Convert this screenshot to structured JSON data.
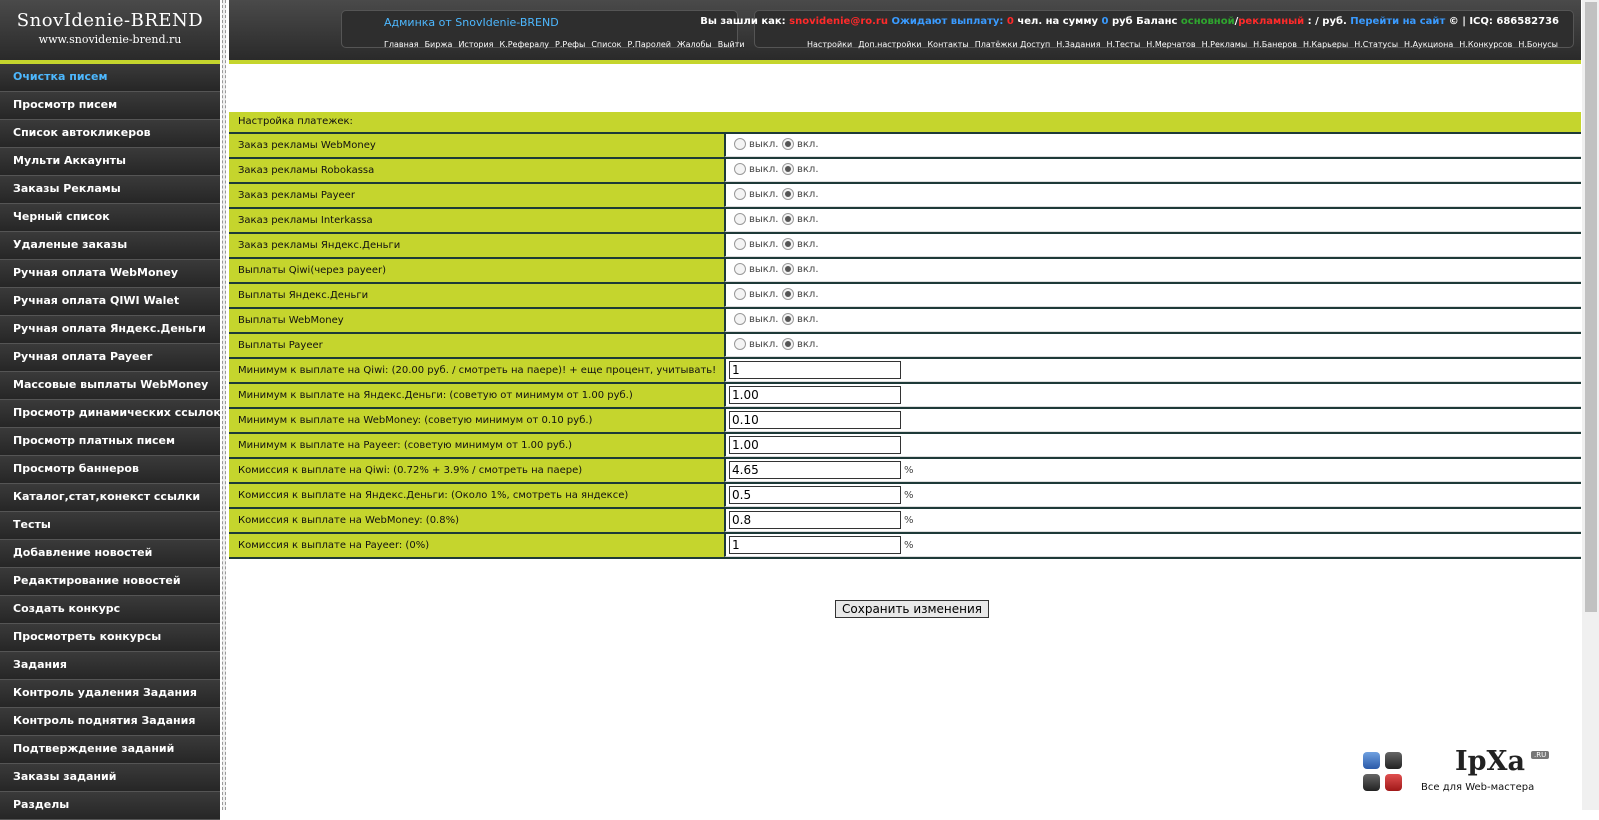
{
  "logo": {
    "title": "SnovIdenie-BREND",
    "url": "www.snovidenie-brend.ru"
  },
  "sidebar": {
    "items": [
      {
        "label": "Очистка писем",
        "active": true
      },
      {
        "label": "Просмотр писем"
      },
      {
        "label": "Список автокликеров"
      },
      {
        "label": "Мульти Аккаунты"
      },
      {
        "label": "Заказы Рекламы"
      },
      {
        "label": "Черный список"
      },
      {
        "label": "Удаленые заказы"
      },
      {
        "label": "Ручная оплата WebMoney"
      },
      {
        "label": "Ручная оплата QIWI Walet"
      },
      {
        "label": "Ручная оплата Яндекс.Деньги"
      },
      {
        "label": "Ручная оплата Payeer"
      },
      {
        "label": "Массовые выплаты WebMoney"
      },
      {
        "label": "Просмотр динамических ссылок"
      },
      {
        "label": "Просмотр платных писем"
      },
      {
        "label": "Просмотр баннеров"
      },
      {
        "label": "Каталог,стат,конекст ссылки"
      },
      {
        "label": "Тесты"
      },
      {
        "label": "Добавление новостей"
      },
      {
        "label": "Редактирование новостей"
      },
      {
        "label": "Создать конкурс"
      },
      {
        "label": "Просмотреть конкурсы"
      },
      {
        "label": "Задания"
      },
      {
        "label": "Контроль удаления Задания"
      },
      {
        "label": "Контроль поднятия Задания"
      },
      {
        "label": "Подтверждение заданий"
      },
      {
        "label": "Заказы заданий"
      },
      {
        "label": "Разделы"
      }
    ]
  },
  "header": {
    "admin_title": "Админка от SnovIdenie-BREND",
    "nav_left": [
      "Главная",
      "Биржа",
      "История",
      "К.Рефералу",
      "Р.Рефы",
      "Список",
      "Р.Паролей",
      "Жалобы",
      "Выйти"
    ],
    "info": {
      "logged_as": "Вы зашли как:",
      "email": "snovidenie@ro.ru",
      "waiting": "Ожидают выплату:",
      "count": "0",
      "people_sum": "чел. на сумму",
      "sum": "0",
      "rub_balance": "руб Баланс",
      "main": "основной",
      "slash": "/",
      "ad": "рекламный",
      "rub_end": ": / руб.",
      "goto_site": "Перейти на сайт",
      "icq": "© | ICQ: 686582736"
    },
    "nav_right": [
      "Настройки",
      "Доп.настройки",
      "Контакты",
      "Платёжки Доступ",
      "Н.Задания",
      "Н.Тесты",
      "Н.Мерчатов",
      "Н.Рекламы",
      "Н.Банеров",
      "Н.Карьеры",
      "Н.Статусы",
      "Н.Аукциона",
      "Н.Конкурсов",
      "Н.Бонусы"
    ]
  },
  "settings": {
    "section_title": "Настройка платежек:",
    "off_label": "выкл.",
    "on_label": "вкл.",
    "toggles": [
      {
        "label": "Заказ рекламы WebMoney",
        "value": "вкл."
      },
      {
        "label": "Заказ рекламы Robokassa",
        "value": "вкл."
      },
      {
        "label": "Заказ рекламы Payeer",
        "value": "вкл."
      },
      {
        "label": "Заказ рекламы Interkassa",
        "value": "вкл."
      },
      {
        "label": "Заказ рекламы Яндекс.Деньги",
        "value": "вкл."
      },
      {
        "label": "Выплаты Qiwi(через payeer)",
        "value": "вкл."
      },
      {
        "label": "Выплаты Яндекс.Деньги",
        "value": "вкл."
      },
      {
        "label": "Выплаты WebMoney",
        "value": "вкл."
      },
      {
        "label": "Выплаты Payeer",
        "value": "вкл."
      }
    ],
    "inputs": [
      {
        "label": "Минимум к выплате на Qiwi: (20.00 руб. / смотреть на паере)! + еще процент, учитывать!",
        "value": "1",
        "suffix": ""
      },
      {
        "label": "Минимум к выплате на Яндекс.Деньги: (советую от минимум от 1.00 руб.)",
        "value": "1.00",
        "suffix": ""
      },
      {
        "label": "Минимум к выплате на WebMoney: (советую минимум от 0.10 руб.)",
        "value": "0.10",
        "suffix": ""
      },
      {
        "label": "Минимум к выплате на Payeer: (советую минимум от 1.00 руб.)",
        "value": "1.00",
        "suffix": ""
      },
      {
        "label": "Комиссия к выплате на Qiwi: (0.72% + 3.9% / смотреть на паере)",
        "value": "4.65",
        "suffix": "%"
      },
      {
        "label": "Комиссия к выплате на Яндекс.Деньги: (Около 1%, смотреть на яндексе)",
        "value": "0.5",
        "suffix": "%"
      },
      {
        "label": "Комиссия к выплате на WebMoney: (0.8%)",
        "value": "0.8",
        "suffix": "%"
      },
      {
        "label": "Комиссия к выплате на Payeer: (0%)",
        "value": "1",
        "suffix": "%"
      }
    ],
    "save_label": "Сохранить изменения"
  },
  "watermark": {
    "brand": "IpXa",
    "tld": ".RU",
    "tagline": "Все для Web-мастера"
  },
  "colors": {
    "accent": "#c5d52d",
    "dark": "#2f2f2f",
    "link": "#4db8ff",
    "red": "#ff2a2a"
  }
}
